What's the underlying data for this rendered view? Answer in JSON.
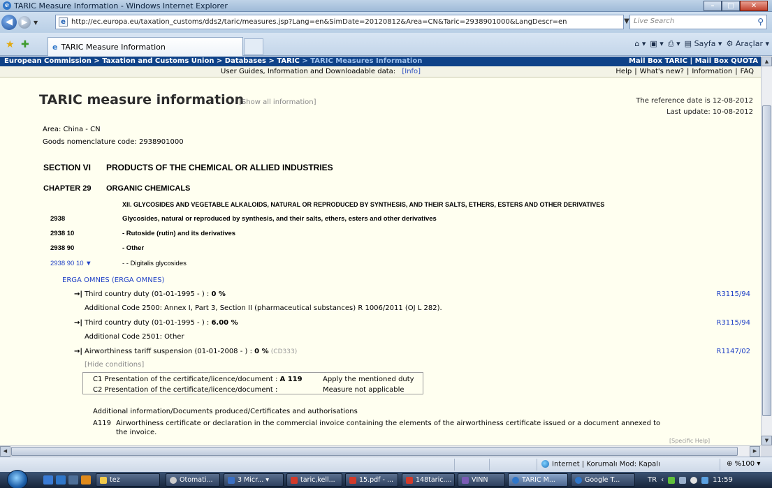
{
  "window": {
    "title": "TARIC Measure Information - Windows Internet Explorer",
    "url": "http://ec.europa.eu/taxation_customs/dds2/taric/measures.jsp?Lang=en&SimDate=20120812&Area=CN&Taric=2938901000&LangDescr=en",
    "search_placeholder": "Live Search",
    "tab_title": "TARIC Measure Information",
    "cmd_page": "Sayfa",
    "cmd_tools": "Araçlar"
  },
  "site_nav": {
    "breadcrumb_1": "European Commission",
    "breadcrumb_2": "Taxation and Customs Union",
    "breadcrumb_3": "Databases",
    "breadcrumb_4": "TARIC",
    "breadcrumb_current": "TARIC Measures Information",
    "separator": ">",
    "mailbox_taric": "Mail Box TARIC",
    "mailbox_quota": "Mail Box QUOTA",
    "guides_text": "User Guides, Information and Downloadable data:",
    "info_link": "[Info]",
    "links": [
      "Help",
      "What's new?",
      "Information",
      "FAQ"
    ]
  },
  "page": {
    "title": "TARIC measure information",
    "show_all": "[Show all information]",
    "reference_date": "The reference date is 12-08-2012",
    "last_update": "Last update:  10-08-2012",
    "area": "Area: China - CN",
    "goods_code": "Goods nomenclature code: 2938901000",
    "section_num": "SECTION VI",
    "section_title": "PRODUCTS OF THE CHEMICAL OR ALLIED INDUSTRIES",
    "chapter_num": "CHAPTER 29",
    "chapter_title": "ORGANIC CHEMICALS",
    "heading_xii": "XII. GLYCOSIDES AND VEGETABLE ALKALOIDS, NATURAL OR REPRODUCED BY SYNTHESIS, AND THEIR SALTS, ETHERS, ESTERS AND OTHER DERIVATIVES",
    "rows": [
      {
        "code": "2938",
        "desc": "Glycosides, natural or reproduced by synthesis, and their salts, ethers, esters and other derivatives"
      },
      {
        "code": "2938 10",
        "desc": "- Rutoside (rutin) and its derivatives"
      },
      {
        "code": "2938 90",
        "desc": "- Other"
      },
      {
        "code": "2938 90 10 ▼",
        "desc": "- - Digitalis glycosides"
      }
    ],
    "erga": "ERGA OMNES (ERGA OMNES)",
    "measures": [
      {
        "arrow": "→|",
        "label": "Third country duty (01-01-1995 - ) : ",
        "value": "0 %",
        "reg": "R3115/94",
        "additional": "Additional Code 2500: Annex I, Part 3, Section II (pharmaceutical substances) R 1006/2011 (OJ L 282)."
      },
      {
        "arrow": "→|",
        "label": "Third country duty (01-01-1995 - ) : ",
        "value": "6.00 %",
        "reg": "R3115/94",
        "additional": "Additional Code 2501: Other"
      },
      {
        "arrow": "→|",
        "label": "Airworthiness tariff suspension (01-01-2008 - ) : ",
        "value": "0 %",
        "cd": "(CD333)",
        "reg": "R1147/02"
      }
    ],
    "hide_conditions": "[Hide conditions]",
    "conditions": [
      {
        "label": "C1 Presentation of the certificate/licence/document : ",
        "code": "A 119",
        "value": "Apply the mentioned duty"
      },
      {
        "label": "C2 Presentation of the certificate/licence/document : ",
        "code": "",
        "value": "Measure not applicable"
      }
    ],
    "additional_info_title": "Additional information/Documents produced/Certificates and authorisations",
    "a119_code": "A119",
    "a119_text_1": "Airworthiness certificate or declaration in the commercial invoice containing the elements of the airworthiness certificate issued or a document annexed to",
    "a119_text_2": "the invoice.",
    "specific_help": "[Specific Help]"
  },
  "status": {
    "zone": "Internet | Korumalı Mod: Kapalı",
    "zoom": "%100"
  },
  "taskbar": {
    "items": [
      "tez",
      "Otomati...",
      "3 Micr...",
      "taric,kell...",
      "15.pdf - ...",
      "148taric....",
      "VINN",
      "TARIC M...",
      "Google T..."
    ],
    "lang": "TR",
    "time": "11:59"
  },
  "colors": {
    "site_nav_bg": "#0f4288",
    "link_blue": "#2142c6",
    "content_bg": "#fffff0"
  }
}
